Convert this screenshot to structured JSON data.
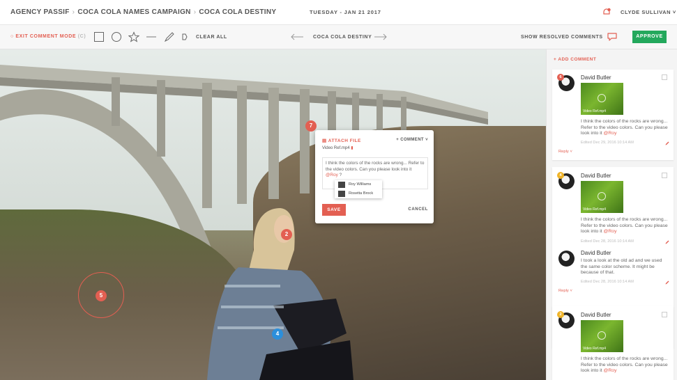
{
  "header": {
    "breadcrumbs": [
      "AGENCY PASSIF",
      "COCA COLA NAMES CAMPAIGN",
      "COCA COLA DESTINY"
    ],
    "date": "TUESDAY - JAN 21 2017",
    "user": "CLYDE SULLIVAN"
  },
  "toolbar": {
    "exit_label": "EXIT COMMENT MODE",
    "exit_shortcut": "(C)",
    "tools": [
      "rectangle-icon",
      "circle-icon",
      "star-icon",
      "line-icon",
      "pen-icon",
      "eraser-icon"
    ],
    "clear_all": "CLEAR ALL",
    "nav_title": "COCA COLA DESTINY",
    "show_resolved": "SHOW RESOLVED COMMENTS",
    "approve": "APPROVE"
  },
  "pins": [
    {
      "num": "7",
      "color": "red"
    },
    {
      "num": "2",
      "color": "red"
    },
    {
      "num": "5",
      "color": "red"
    },
    {
      "num": "4",
      "color": "blue"
    }
  ],
  "popup": {
    "attach": "ATTACH FILE",
    "type": "+ COMMENT",
    "file": "Video Ref.mp4",
    "text": "I think the colors of the rocks are wrong... Refer to the video colors. Can you please look into it",
    "mention": "@Roy",
    "mention_suffix": " ?",
    "suggestions": [
      "Roy Williams",
      "Rosetta Brock"
    ],
    "save": "SAVE",
    "cancel": "CANCEL"
  },
  "sidebar": {
    "add_comment": "+ ADD COMMENT",
    "comments": [
      {
        "badge": "6",
        "name": "David Butler",
        "video": "Video Ref.mp4",
        "text": "I think the colors of the rocks are wrong... Refer to the video colors. Can you please look into it",
        "mention": "@Roy",
        "date": "Edited Dec 29, 2016 10:14 AM",
        "reply": "Reply"
      },
      {
        "badge": "4",
        "name": "David Butler",
        "video": "Video Ref.mp4",
        "text": "I think the colors of the rocks are wrong... Refer to the video colors. Can you please look into it",
        "mention": "@Roy",
        "date": "Edited Dec 28, 2016 10:14 AM"
      },
      {
        "name": "David Butler",
        "text": "I took a look at the old ad and we used the same color scheme. It might be because of that.",
        "date": "Edited Dec 28, 2016 10:14 AM",
        "reply": "Reply"
      },
      {
        "badge": "2",
        "name": "David Butler",
        "video": "Video Ref.mp4",
        "text": "I think the colors of the rocks are wrong... Refer to the video colors. Can you please look into it",
        "mention": "@Roy"
      }
    ]
  },
  "colors": {
    "accent": "#e35f52",
    "approve": "#23a85c",
    "pin_blue": "#2b8fdc"
  }
}
